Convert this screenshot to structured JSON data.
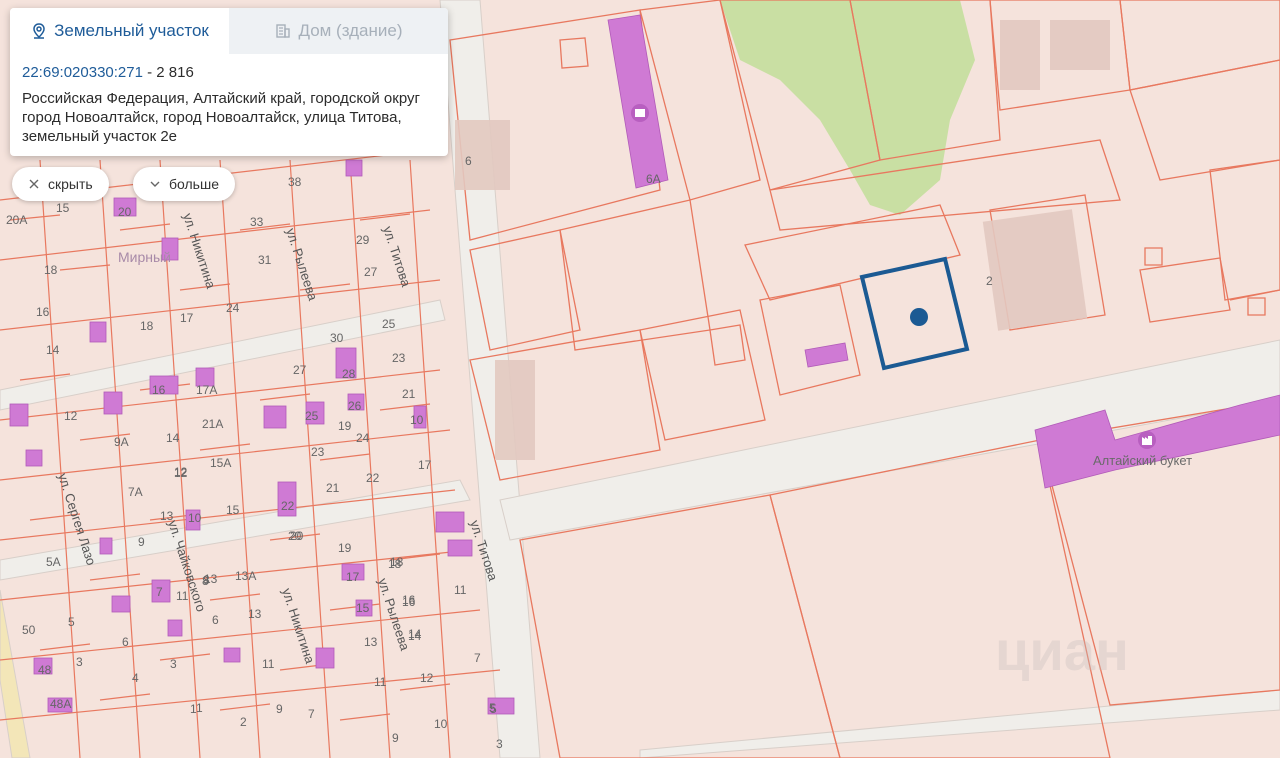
{
  "tabs": [
    {
      "label": "Земельный участок",
      "icon": "location-pin-icon",
      "active": true
    },
    {
      "label": "Дом (здание)",
      "icon": "building-icon",
      "active": false
    }
  ],
  "parcel": {
    "cadastral_number": "22:69:020330:271",
    "separator": " - ",
    "area": "2 816",
    "address": "Российская Федерация, Алтайский край, городской округ город Новоалтайск, город Новоалтайск, улица Титова, земельный участок 2е"
  },
  "buttons": {
    "hide_label": "скрыть",
    "more_label": "больше"
  },
  "map": {
    "district_label": "Мирный",
    "poi_label": "Алтайский букет",
    "watermark": "циан",
    "streets": [
      "ул. Никитина",
      "ул. Рылеева",
      "ул. Титова",
      "ул. Сергея Лазо",
      "ул. Чайковского",
      "ул. Никитина",
      "ул. Рылеева",
      "ул. Титова"
    ],
    "house_numbers": [
      "6",
      "6А",
      "2",
      "38",
      "33",
      "31",
      "29",
      "27",
      "24",
      "20А",
      "18",
      "16",
      "14",
      "15",
      "20",
      "18",
      "17",
      "30",
      "25",
      "23",
      "21",
      "19",
      "17",
      "28",
      "26",
      "24",
      "22",
      "27",
      "25",
      "23",
      "21",
      "22",
      "20",
      "18",
      "16",
      "14",
      "12",
      "10",
      "8",
      "12",
      "11",
      "9А",
      "7А",
      "9",
      "13",
      "10",
      "5А",
      "16",
      "17А",
      "14",
      "21А",
      "12",
      "15А",
      "13",
      "15",
      "11",
      "7",
      "3",
      "6",
      "4",
      "5",
      "3",
      "1",
      "8",
      "13А",
      "6",
      "13",
      "11",
      "9",
      "7",
      "5",
      "2",
      "20",
      "19",
      "18",
      "17",
      "16",
      "15",
      "14",
      "13",
      "12",
      "11",
      "10",
      "9",
      "7",
      "5",
      "3",
      "1",
      "50",
      "48",
      "48А"
    ],
    "colors": {
      "background": "#f5e3dc",
      "parcel_line": "#e8785f",
      "building": "#cf7ad4",
      "green": "#c9dfa3",
      "road": "#f0eeea",
      "selection": "#1b5a93"
    }
  }
}
